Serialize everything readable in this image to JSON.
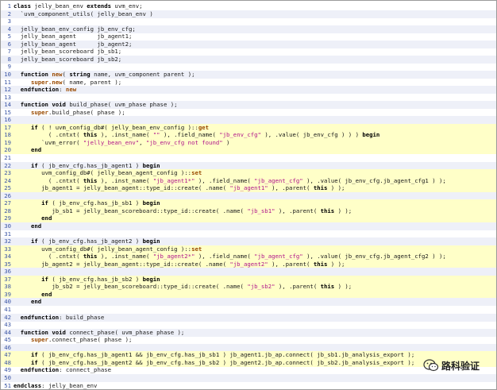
{
  "code_lines": [
    {
      "n": "1",
      "t": "class jelly_bean_env extends uvm_env;"
    },
    {
      "n": "2",
      "t": "  `uvm_component_utils( jelly_bean_env )"
    },
    {
      "n": "3",
      "t": ""
    },
    {
      "n": "4",
      "t": "  jelly_bean_env_config jb_env_cfg;"
    },
    {
      "n": "5",
      "t": "  jelly_bean_agent      jb_agent1;"
    },
    {
      "n": "6",
      "t": "  jelly_bean_agent      jb_agent2;"
    },
    {
      "n": "7",
      "t": "  jelly_bean_scoreboard jb_sb1;"
    },
    {
      "n": "8",
      "t": "  jelly_bean_scoreboard jb_sb2;"
    },
    {
      "n": "9",
      "t": ""
    },
    {
      "n": "10",
      "t": "  function new( string name, uvm_component parent );"
    },
    {
      "n": "11",
      "t": "     super.new( name, parent );"
    },
    {
      "n": "12",
      "t": "  endfunction: new"
    },
    {
      "n": "13",
      "t": ""
    },
    {
      "n": "14",
      "t": "  function void build_phase( uvm_phase phase );"
    },
    {
      "n": "15",
      "t": "     super.build_phase( phase );"
    },
    {
      "n": "16",
      "t": ""
    },
    {
      "n": "17",
      "t": "     if ( ! uvm_config_db#( jelly_bean_env_config )::get"
    },
    {
      "n": "18",
      "t": "          ( .cntxt( this ), .inst_name( \"\" ), .field_name( \"jb_env_cfg\" ), .value( jb_env_cfg ) ) ) begin"
    },
    {
      "n": "19",
      "t": "        `uvm_error( \"jelly_bean_env\", \"jb_env_cfg not found\" )"
    },
    {
      "n": "20",
      "t": "     end"
    },
    {
      "n": "21",
      "t": ""
    },
    {
      "n": "22",
      "t": "     if ( jb_env_cfg.has_jb_agent1 ) begin"
    },
    {
      "n": "23",
      "t": "        uvm_config_db#( jelly_bean_agent_config )::set"
    },
    {
      "n": "24",
      "t": "          ( .cntxt( this ), .inst_name( \"jb_agent1*\" ), .field_name( \"jb_agent_cfg\" ), .value( jb_env_cfg.jb_agent_cfg1 ) );"
    },
    {
      "n": "25",
      "t": "        jb_agent1 = jelly_bean_agent::type_id::create( .name( \"jb_agent1\" ), .parent( this ) );"
    },
    {
      "n": "26",
      "t": ""
    },
    {
      "n": "27",
      "t": "        if ( jb_env_cfg.has_jb_sb1 ) begin"
    },
    {
      "n": "28",
      "t": "           jb_sb1 = jelly_bean_scoreboard::type_id::create( .name( \"jb_sb1\" ), .parent( this ) );"
    },
    {
      "n": "29",
      "t": "        end"
    },
    {
      "n": "30",
      "t": "     end"
    },
    {
      "n": "31",
      "t": ""
    },
    {
      "n": "32",
      "t": "     if ( jb_env_cfg.has_jb_agent2 ) begin"
    },
    {
      "n": "33",
      "t": "        uvm_config_db#( jelly_bean_agent_config )::set"
    },
    {
      "n": "34",
      "t": "          ( .cntxt( this ), .inst_name( \"jb_agent2*\" ), .field_name( \"jb_agent_cfg\" ), .value( jb_env_cfg.jb_agent_cfg2 ) );"
    },
    {
      "n": "35",
      "t": "        jb_agent2 = jelly_bean_agent::type_id::create( .name( \"jb_agent2\" ), .parent( this ) );"
    },
    {
      "n": "36",
      "t": ""
    },
    {
      "n": "37",
      "t": "        if ( jb_env_cfg.has_jb_sb2 ) begin"
    },
    {
      "n": "38",
      "t": "           jb_sb2 = jelly_bean_scoreboard::type_id::create( .name( \"jb_sb2\" ), .parent( this ) );"
    },
    {
      "n": "39",
      "t": "        end"
    },
    {
      "n": "40",
      "t": "     end"
    },
    {
      "n": "41",
      "t": ""
    },
    {
      "n": "42",
      "t": "  endfunction: build_phase"
    },
    {
      "n": "43",
      "t": ""
    },
    {
      "n": "44",
      "t": "  function void connect_phase( uvm_phase phase );"
    },
    {
      "n": "45",
      "t": "     super.connect_phase( phase );"
    },
    {
      "n": "46",
      "t": ""
    },
    {
      "n": "47",
      "t": "     if ( jb_env_cfg.has_jb_agent1 && jb_env_cfg.has_jb_sb1 ) jb_agent1.jb_ap.connect( jb_sb1.jb_analysis_export );"
    },
    {
      "n": "48",
      "t": "     if ( jb_env_cfg.has_jb_agent2 && jb_env_cfg.has_jb_sb2 ) jb_agent2.jb_ap.connect( jb_sb2.jb_analysis_export );"
    },
    {
      "n": "49",
      "t": "  endfunction: connect_phase"
    },
    {
      "n": "50",
      "t": ""
    },
    {
      "n": "51",
      "t": "endclass: jelly_bean_env"
    }
  ],
  "highlighted_lines": [
    17,
    18,
    19,
    20,
    23,
    24,
    25,
    27,
    28,
    29,
    33,
    34,
    35,
    37,
    38,
    39,
    47,
    48
  ],
  "watermark": {
    "text": "路科验证",
    "icon": "wechat-icon"
  },
  "colors": {
    "keyword": "#000000",
    "string": "#b0148a",
    "line_number": "#3a55a5",
    "highlight": "#ffffc8",
    "alt_row": "#eef0f8"
  }
}
